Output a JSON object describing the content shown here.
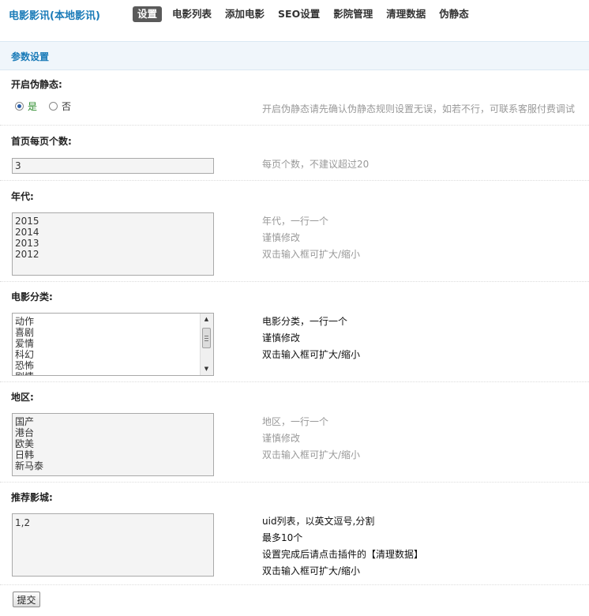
{
  "app": {
    "title": "电影影讯(本地影讯)"
  },
  "nav": {
    "tabs": [
      {
        "label": "设置",
        "active": true
      },
      {
        "label": "电影列表",
        "active": false
      },
      {
        "label": "添加电影",
        "active": false
      },
      {
        "label": "SEO设置",
        "active": false
      },
      {
        "label": "影院管理",
        "active": false
      },
      {
        "label": "清理数据",
        "active": false
      },
      {
        "label": "伪静态",
        "active": false
      }
    ]
  },
  "section": {
    "title": "参数设置"
  },
  "fields": {
    "pseudo_static": {
      "label": "开启伪静态:",
      "options": [
        {
          "label": "是",
          "checked": true
        },
        {
          "label": "否",
          "checked": false
        }
      ],
      "help": "开启伪静态请先确认伪静态规则设置无误，如若不行，可联系客服付费调试"
    },
    "per_page": {
      "label": "首页每页个数:",
      "value": "3",
      "help": "每页个数，不建议超过20"
    },
    "years": {
      "label": "年代:",
      "lines": [
        "2015",
        "2014",
        "2013",
        "2012"
      ],
      "help": [
        "年代，一行一个",
        "谨慎修改",
        "双击输入框可扩大/缩小"
      ]
    },
    "categories": {
      "label": "电影分类:",
      "lines": [
        "动作",
        "喜剧",
        "爱情",
        "科幻",
        "恐怖",
        "剧情"
      ],
      "help": [
        "电影分类，一行一个",
        "谨慎修改",
        "双击输入框可扩大/缩小"
      ]
    },
    "regions": {
      "label": "地区:",
      "lines": [
        "国产",
        "港台",
        "欧美",
        "日韩",
        "新马泰"
      ],
      "help": [
        "地区，一行一个",
        "谨慎修改",
        "双击输入框可扩大/缩小"
      ]
    },
    "recommend": {
      "label": "推荐影城:",
      "lines": [
        "1,2"
      ],
      "help": [
        "uid列表，以英文逗号,分割",
        "最多10个",
        "设置完成后请点击插件的【清理数据】",
        "双击输入框可扩大/缩小"
      ]
    }
  },
  "submit": {
    "label": "提交"
  }
}
